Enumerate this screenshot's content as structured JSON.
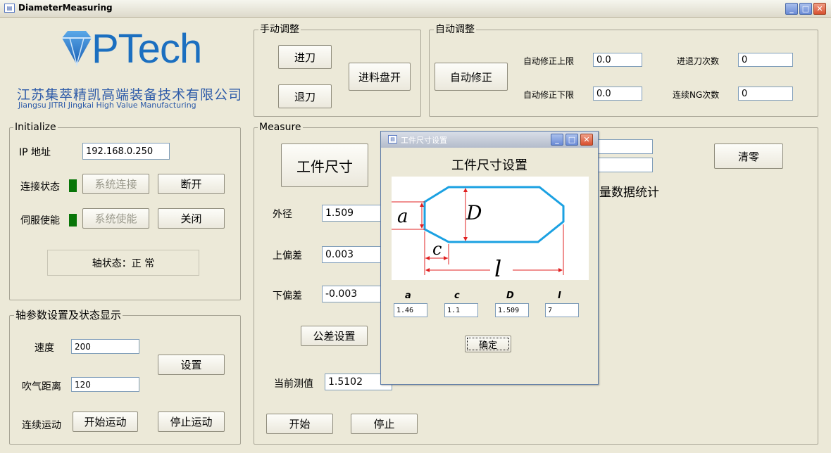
{
  "window": {
    "title": "DiameterMeasuring"
  },
  "logo": {
    "brand": "PTech",
    "company_cn": "江苏集萃精凯高端装备技术有限公司",
    "company_en": "Jiangsu JITRI Jingkai High Value Manufacturing"
  },
  "manual": {
    "legend": "手动调整",
    "advance": "进刀",
    "retract": "退刀",
    "feed_open": "进料盘开"
  },
  "auto": {
    "legend": "自动调整",
    "auto_correct": "自动修正",
    "upper_label": "自动修正上限",
    "upper_value": "0.0",
    "lower_label": "自动修正下限",
    "lower_value": "0.0",
    "advance_count_label": "进退刀次数",
    "advance_count_value": "0",
    "ng_count_label": "连续NG次数",
    "ng_count_value": "0"
  },
  "initialize": {
    "legend": "Initialize",
    "ip_label": "IP 地址",
    "ip_value": "192.168.0.250",
    "conn_label": "连接状态",
    "connect_btn": "系统连接",
    "disconnect_btn": "断开",
    "servo_label": "伺服使能",
    "enable_btn": "系统使能",
    "close_btn": "关闭",
    "axis_status": "轴状态：正 常",
    "led_color": "#087508"
  },
  "axis": {
    "legend": "轴参数设置及状态显示",
    "speed_label": "速度",
    "speed_value": "200",
    "blow_label": "吹气距离",
    "blow_value": "120",
    "set_btn": "设置",
    "motion_label": "连续运动",
    "start_motion": "开始运动",
    "stop_motion": "停止运动"
  },
  "measure": {
    "legend": "Measure",
    "workpiece_btn": "工件尺寸",
    "od_label": "外径",
    "od_value": "1.509",
    "upper_dev_label": "上偏差",
    "upper_dev_value": "0.003",
    "lower_dev_label": "下偏差",
    "lower_dev_value": "-0.003",
    "tolerance_btn": "公差设置",
    "current_label": "当前测值",
    "current_value": "1.5102",
    "start_btn": "开始",
    "stop_btn": "停止",
    "clear_btn": "清零",
    "stats_label": "量数据统计"
  },
  "dialog": {
    "title": "工件尺寸设置",
    "heading": "工件尺寸设置",
    "diagram_labels": {
      "a": "a",
      "c": "c",
      "D": "D",
      "l": "l"
    },
    "fields": [
      {
        "label": "a",
        "value": "1.46"
      },
      {
        "label": "c",
        "value": "1.1"
      },
      {
        "label": "D",
        "value": "1.509"
      },
      {
        "label": "l",
        "value": "7"
      }
    ],
    "ok_btn": "确定"
  },
  "colors": {
    "shape_stroke": "#1ba1e2",
    "dim_line": "#e02020"
  }
}
